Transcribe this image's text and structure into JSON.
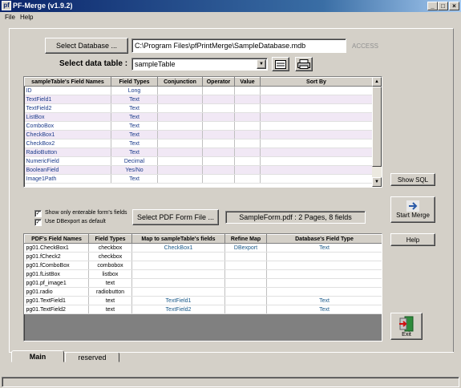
{
  "window": {
    "title": "PF-Merge (v1.9.2)",
    "app_icon": "pf",
    "min": "_",
    "max": "□",
    "close": "×"
  },
  "menu": {
    "file": "File",
    "help": "Help"
  },
  "database": {
    "button": "Select Database ...",
    "path": "C:\\Program Files\\pfPrintMerge\\SampleDatabase.mdb",
    "type": "ACCESS"
  },
  "data_table": {
    "label": "Select data table :",
    "selected": "sampleTable"
  },
  "table_grid": {
    "headers": [
      "sampleTable's Field Names",
      "Field Types",
      "Conjunction",
      "Operator",
      "Value",
      "Sort By"
    ],
    "rows": [
      [
        "ID",
        "Long"
      ],
      [
        "TextField1",
        "Text"
      ],
      [
        "TextField2",
        "Text"
      ],
      [
        "ListBox",
        "Text"
      ],
      [
        "ComboBox",
        "Text"
      ],
      [
        "CheckBox1",
        "Text"
      ],
      [
        "CheckBox2",
        "Text"
      ],
      [
        "RadioButton",
        "Text"
      ],
      [
        "NumericField",
        "Decimal"
      ],
      [
        "BooleanField",
        "Yes/No"
      ],
      [
        "Image1Path",
        "Text"
      ]
    ]
  },
  "side_buttons": {
    "show_sql": "Show SQL",
    "start_merge": "Start Merge",
    "help": "Help",
    "exit": "Exit"
  },
  "options": {
    "show_enterable": "Show only enterable form's fields",
    "use_dbexport": "Use DBexport as default",
    "show_enterable_checked": "✓",
    "use_dbexport_checked": "✓"
  },
  "pdf": {
    "button": "Select PDF Form File ...",
    "info": "SampleForm.pdf : 2 Pages, 8 fields"
  },
  "form_grid": {
    "headers": [
      "PDF's Field Names",
      "Field Types",
      "Map to sampleTable's fields",
      "Refine Map",
      "Database's Field Type"
    ],
    "rows": [
      [
        "pg01.CheckBox1",
        "checkbox",
        "CheckBox1",
        "DBexport",
        "Text"
      ],
      [
        "pg01.fCheck2",
        "checkbox",
        "",
        "",
        ""
      ],
      [
        "pg01.fComboBox",
        "combobox",
        "",
        "",
        ""
      ],
      [
        "pg01.fListBox",
        "listbox",
        "",
        "",
        ""
      ],
      [
        "pg01.pf_image1",
        "text",
        "",
        "",
        ""
      ],
      [
        "pg01.radio",
        "radiobutton",
        "",
        "",
        ""
      ],
      [
        "pg01.TextField1",
        "text",
        "TextField1",
        "",
        "Text"
      ],
      [
        "pg01.TextField2",
        "text",
        "TextField2",
        "",
        "Text"
      ]
    ]
  },
  "tabs": {
    "main": "Main",
    "reserved": "reserved"
  },
  "colors": {
    "title_bar": "#0a246a",
    "grid_alt_row": "#f1e8f5",
    "mapped_text": "#1a1a80",
    "exit_icon": "#2e8b3c"
  }
}
